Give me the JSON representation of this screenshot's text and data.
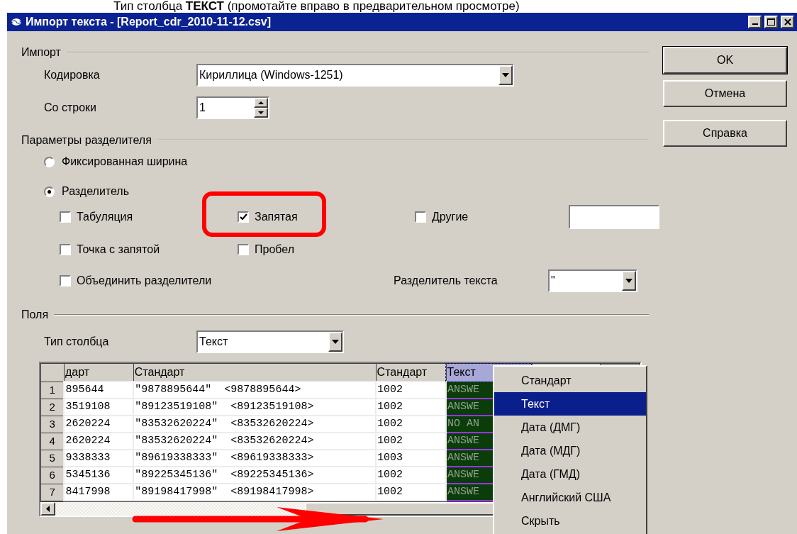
{
  "caption": "Тип столбца **ТЕКСТ** (промотайте вправо в предварительном просмотре)",
  "window": {
    "title": "Импорт текста - [Report_cdr_2010-11-12.csv]"
  },
  "import": {
    "heading": "Импорт",
    "encoding": {
      "label": "Кодировка",
      "value": "Кириллица (Windows-1251)"
    },
    "from_row": {
      "label": "Со строки",
      "value": "1"
    }
  },
  "separator_options": {
    "heading": "Параметры разделителя",
    "modes": [
      {
        "label": "Фиксированная ширина",
        "selected": false
      },
      {
        "label": "Разделитель",
        "selected": true
      }
    ],
    "separators": [
      {
        "kind": "checkbox",
        "label": "Табуляция",
        "checked": false,
        "highlighted": false
      },
      {
        "kind": "checkbox",
        "label": "Запятая",
        "checked": true,
        "highlighted": true
      },
      {
        "kind": "other",
        "label": "Другие",
        "checked": false,
        "highlighted": false
      },
      {
        "kind": "checkbox",
        "label": "Точка с запятой",
        "checked": false,
        "highlighted": false
      },
      {
        "kind": "checkbox",
        "label": "Пробел",
        "checked": false,
        "highlighted": false
      }
    ],
    "merge": {
      "label": "Объединить разделители",
      "checked": false
    },
    "text_delimiter": {
      "label": "Разделитель текста",
      "value": "\""
    }
  },
  "fields": {
    "heading": "Поля",
    "column_type": {
      "label": "Тип столбца",
      "value": "Текст"
    },
    "preview": {
      "annotation_arrow": true,
      "columns": [
        {
          "label": "дарт",
          "selected": false
        },
        {
          "label": "Стандарт",
          "selected": false
        },
        {
          "label": "Стандарт",
          "selected": false
        },
        {
          "label": "Текст",
          "selected": true
        },
        {
          "selected": false
        }
      ],
      "rows": [
        {
          "number": "1",
          "cells": [
            "895644",
            "\"9878895644\"  <9878895644>",
            "1002",
            "ANSWE"
          ]
        },
        {
          "number": "2",
          "cells": [
            "3519108",
            "\"89123519108\"  <89123519108>",
            "1002",
            "ANSWE"
          ]
        },
        {
          "number": "3",
          "cells": [
            "2620224",
            "\"83532620224\"  <83532620224>",
            "1002",
            "NO AN"
          ]
        },
        {
          "number": "4",
          "cells": [
            "2620224",
            "\"83532620224\"  <83532620224>",
            "1002",
            "ANSWE"
          ]
        },
        {
          "number": "5",
          "cells": [
            "9338333",
            "\"89619338333\"  <89619338333>",
            "1003",
            "ANSWE"
          ]
        },
        {
          "number": "6",
          "cells": [
            "5345136",
            "\"89225345136\"  <89225345136>",
            "1002",
            "ANSWE"
          ]
        },
        {
          "number": "7",
          "cells": [
            "8417998",
            "\"89198417998\"  <89198417998>",
            "1002",
            "ANSWE"
          ]
        }
      ]
    }
  },
  "type_menu": {
    "items": [
      {
        "label": "Стандарт",
        "selected": false
      },
      {
        "label": "Текст",
        "selected": true
      },
      {
        "label": "Дата (ДМГ)",
        "selected": false
      },
      {
        "label": "Дата (МДГ)",
        "selected": false
      },
      {
        "label": "Дата (ГМД)",
        "selected": false
      },
      {
        "label": "Английский США",
        "selected": false
      },
      {
        "label": "Скрыть",
        "selected": false
      }
    ]
  },
  "buttons": [
    {
      "label": "OK",
      "default": true
    },
    {
      "label": "Отмена",
      "default": false
    },
    {
      "label": "Справка",
      "default": false
    }
  ]
}
